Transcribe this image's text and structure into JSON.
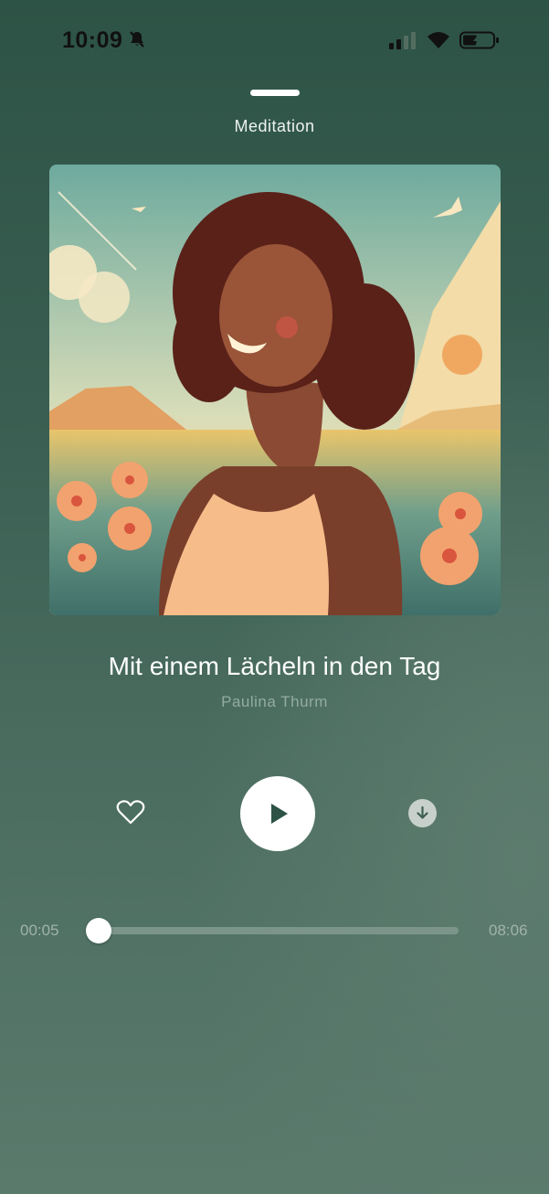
{
  "status_bar": {
    "time": "10:09",
    "icons": [
      "bell-slash-icon",
      "cellular-signal-icon",
      "wifi-icon",
      "battery-charging-icon"
    ]
  },
  "header": {
    "category": "Meditation"
  },
  "track": {
    "title": "Mit einem Lächeln in den Tag",
    "artist": "Paulina Thurm",
    "artwork": "woman-smiling-in-flower-field-illustration"
  },
  "controls": {
    "favorite_icon": "heart-outline-icon",
    "play_icon": "play-icon",
    "download_icon": "download-icon"
  },
  "progress": {
    "elapsed": "00:05",
    "duration": "08:06",
    "fraction": 0.0103
  },
  "colors": {
    "background_top": "#2d5346",
    "background_bottom": "#5a7a6c",
    "artist_text": "#93aba0",
    "time_text": "#a0b3aa"
  }
}
